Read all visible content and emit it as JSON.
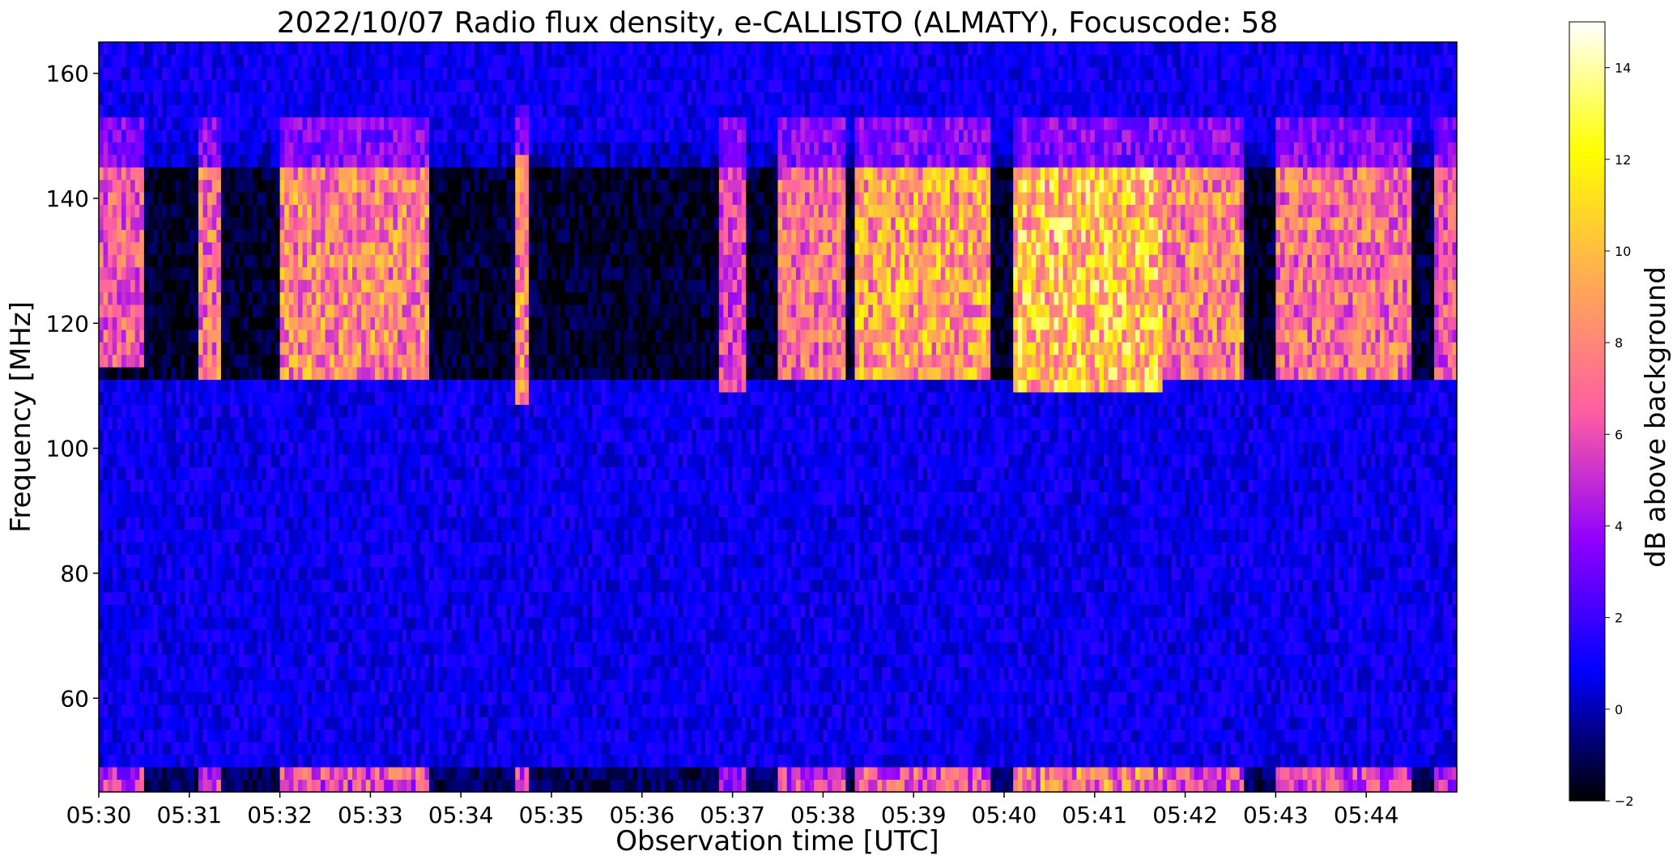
{
  "chart_data": {
    "type": "heatmap",
    "title": "2022/10/07  Radio flux density, e-CALLISTO (ALMATY), Focuscode: 58",
    "xlabel": "Observation time [UTC]",
    "ylabel": "Frequency [MHz]",
    "x_ticks": [
      "05:30",
      "05:31",
      "05:32",
      "05:33",
      "05:34",
      "05:35",
      "05:36",
      "05:37",
      "05:38",
      "05:39",
      "05:40",
      "05:41",
      "05:42",
      "05:43",
      "05:44"
    ],
    "xlim": [
      "05:30",
      "05:45"
    ],
    "y_ticks": [
      60,
      80,
      100,
      120,
      140,
      160
    ],
    "ylim": [
      45,
      165
    ],
    "colorbar": {
      "label": "dB above background",
      "ticks": [
        -2,
        0,
        2,
        4,
        6,
        8,
        10,
        12,
        14
      ],
      "range": [
        -2,
        15
      ],
      "colormap": "gnuplot2",
      "colors": [
        "#000000",
        "#0000ff",
        "#8f00ff",
        "#ff5fa0",
        "#ffaa55",
        "#ffff00",
        "#ffffff"
      ]
    },
    "bursts": [
      {
        "start": "05:30:00",
        "end": "05:30:30",
        "f_low": 113,
        "f_high": 145,
        "max_db": 9
      },
      {
        "start": "05:31:05",
        "end": "05:31:20",
        "f_low": 112,
        "f_high": 145,
        "max_db": 10
      },
      {
        "start": "05:32:00",
        "end": "05:33:40",
        "f_low": 112,
        "f_high": 145,
        "max_db": 11
      },
      {
        "start": "05:34:35",
        "end": "05:34:45",
        "f_low": 108,
        "f_high": 147,
        "max_db": 11
      },
      {
        "start": "05:36:50",
        "end": "05:37:10",
        "f_low": 110,
        "f_high": 145,
        "max_db": 8
      },
      {
        "start": "05:37:30",
        "end": "05:38:15",
        "f_low": 112,
        "f_high": 145,
        "max_db": 10
      },
      {
        "start": "05:38:20",
        "end": "05:39:50",
        "f_low": 112,
        "f_high": 145,
        "max_db": 12
      },
      {
        "start": "05:40:05",
        "end": "05:41:45",
        "f_low": 109,
        "f_high": 145,
        "max_db": 14
      },
      {
        "start": "05:41:45",
        "end": "05:42:40",
        "f_low": 111,
        "f_high": 145,
        "max_db": 11
      },
      {
        "start": "05:43:00",
        "end": "05:44:30",
        "f_low": 112,
        "f_high": 145,
        "max_db": 10
      },
      {
        "start": "05:44:45",
        "end": "05:44:59",
        "f_low": 112,
        "f_high": 145,
        "max_db": 9
      }
    ]
  }
}
